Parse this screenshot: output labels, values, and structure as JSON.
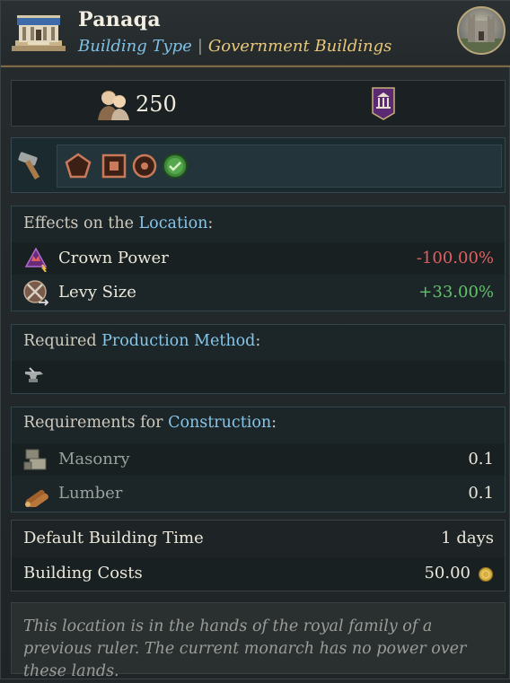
{
  "header": {
    "title": "Panaqa",
    "type_label": "Building Type",
    "separator": "|",
    "type_value": "Government Buildings"
  },
  "stats": {
    "population": "250",
    "population_icon": "people-icon",
    "badge_icon": "government-building-badge-icon"
  },
  "tools": {
    "icons": [
      "hammer-icon",
      "pentagon-icon",
      "square-icon",
      "circle-icon",
      "check-icon"
    ]
  },
  "effects": {
    "heading_prefix": "Effects on the ",
    "heading_link": "Location",
    "heading_suffix": ":",
    "items": [
      {
        "label": "Crown Power",
        "value": "-100.00%",
        "icon": "crown-power-icon",
        "tone": "negative"
      },
      {
        "label": "Levy Size",
        "value": "+33.00%",
        "icon": "levy-size-icon",
        "tone": "positive"
      }
    ]
  },
  "production": {
    "heading_prefix": "Required ",
    "heading_link": "Production Method",
    "heading_suffix": ":",
    "icon": "anvil-icon"
  },
  "requirements": {
    "heading_prefix": "Requirements for ",
    "heading_link": "Construction",
    "heading_suffix": ":",
    "items": [
      {
        "label": "Masonry",
        "value": "0.1",
        "icon": "masonry-icon"
      },
      {
        "label": "Lumber",
        "value": "0.1",
        "icon": "lumber-icon"
      }
    ]
  },
  "construction": {
    "time_label": "Default Building Time",
    "time_value": "1 days",
    "cost_label": "Building Costs",
    "cost_value": "50.00",
    "cost_icon": "gold-coin-icon"
  },
  "description": "This location is in the hands of the royal family of a previous ruler. The current monarch has no power over these lands.",
  "colors": {
    "accent_link": "#86c6ea",
    "gold": "#e8c77a",
    "negative": "#e06060",
    "positive": "#62c26a"
  }
}
